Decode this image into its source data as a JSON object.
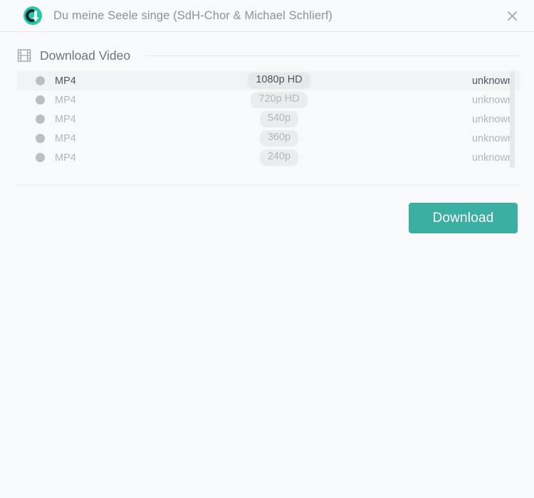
{
  "window": {
    "title": "Du meine Seele singe (SdH-Chor & Michael Schlierf)",
    "logo_icon": "download-circle-logo-icon",
    "close_icon": "close-icon"
  },
  "section": {
    "icon": "film-strip-icon",
    "title": "Download Video"
  },
  "formats": {
    "rows": [
      {
        "format": "MP4",
        "quality": "1080p HD",
        "size": "unknown",
        "selected": true
      },
      {
        "format": "MP4",
        "quality": "720p HD",
        "size": "unknown",
        "selected": false
      },
      {
        "format": "MP4",
        "quality": "540p",
        "size": "unknown",
        "selected": false
      },
      {
        "format": "MP4",
        "quality": "360p",
        "size": "unknown",
        "selected": false
      },
      {
        "format": "MP4",
        "quality": "240p",
        "size": "unknown",
        "selected": false
      }
    ]
  },
  "footer": {
    "download_label": "Download"
  },
  "colors": {
    "accent": "#3aafa2",
    "page_background": "#f8f9fb",
    "selected_row": "#f2f3f5",
    "badge_background": "#ebecee",
    "muted_text": "#b3b6bc",
    "active_text": "#4f5560",
    "title_text": "#8d929b",
    "divider": "#e8eaee"
  }
}
